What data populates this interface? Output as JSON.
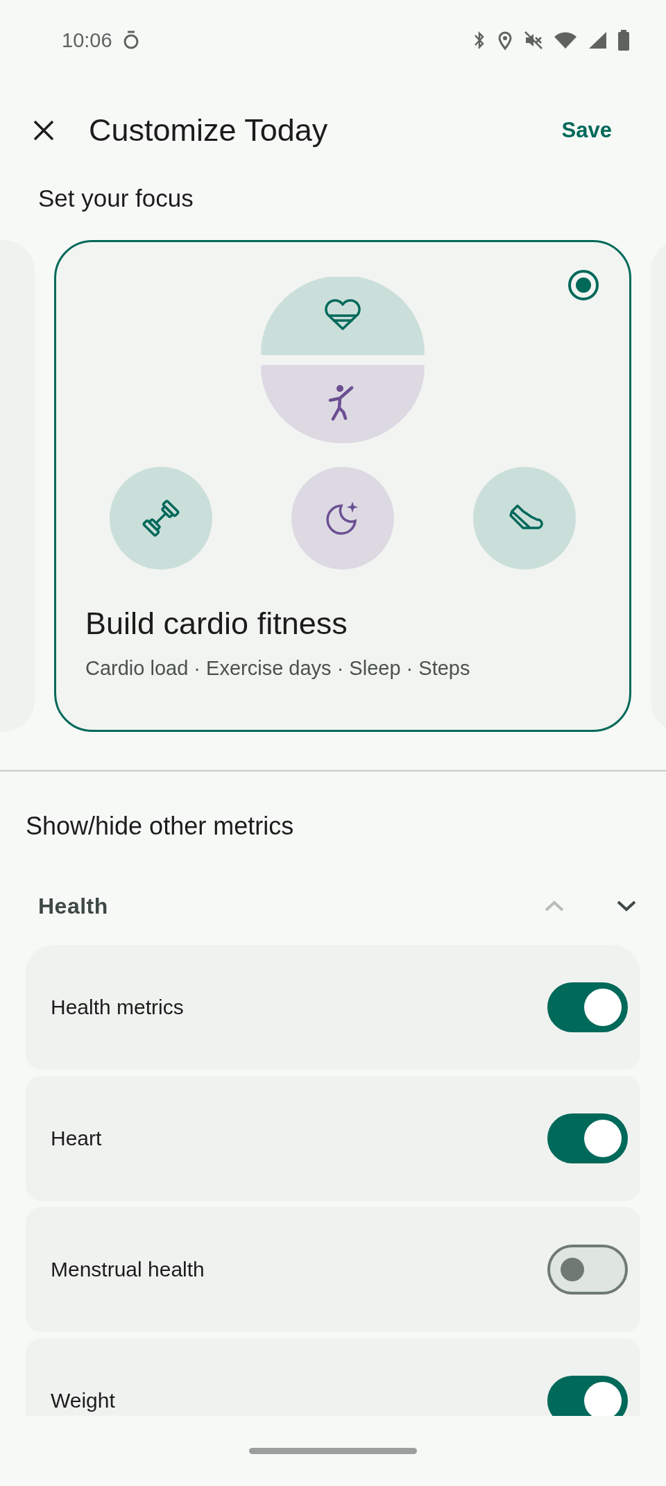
{
  "status_bar": {
    "time": "10:06"
  },
  "header": {
    "title": "Customize Today",
    "action": "Save"
  },
  "focus": {
    "heading": "Set your focus",
    "card": {
      "selected": true,
      "title": "Build cardio fitness",
      "metrics": "Cardio load · Exercise days · Sleep · Steps"
    }
  },
  "metrics": {
    "heading": "Show/hide other metrics",
    "group": {
      "title": "Health",
      "controls": [
        {
          "kind": "up",
          "disabled": true
        },
        {
          "kind": "down",
          "disabled": false
        }
      ],
      "items": [
        {
          "label": "Health metrics",
          "on": true
        },
        {
          "label": "Heart",
          "on": true
        },
        {
          "label": "Menstrual health",
          "on": false
        },
        {
          "label": "Weight",
          "on": true
        }
      ]
    }
  }
}
